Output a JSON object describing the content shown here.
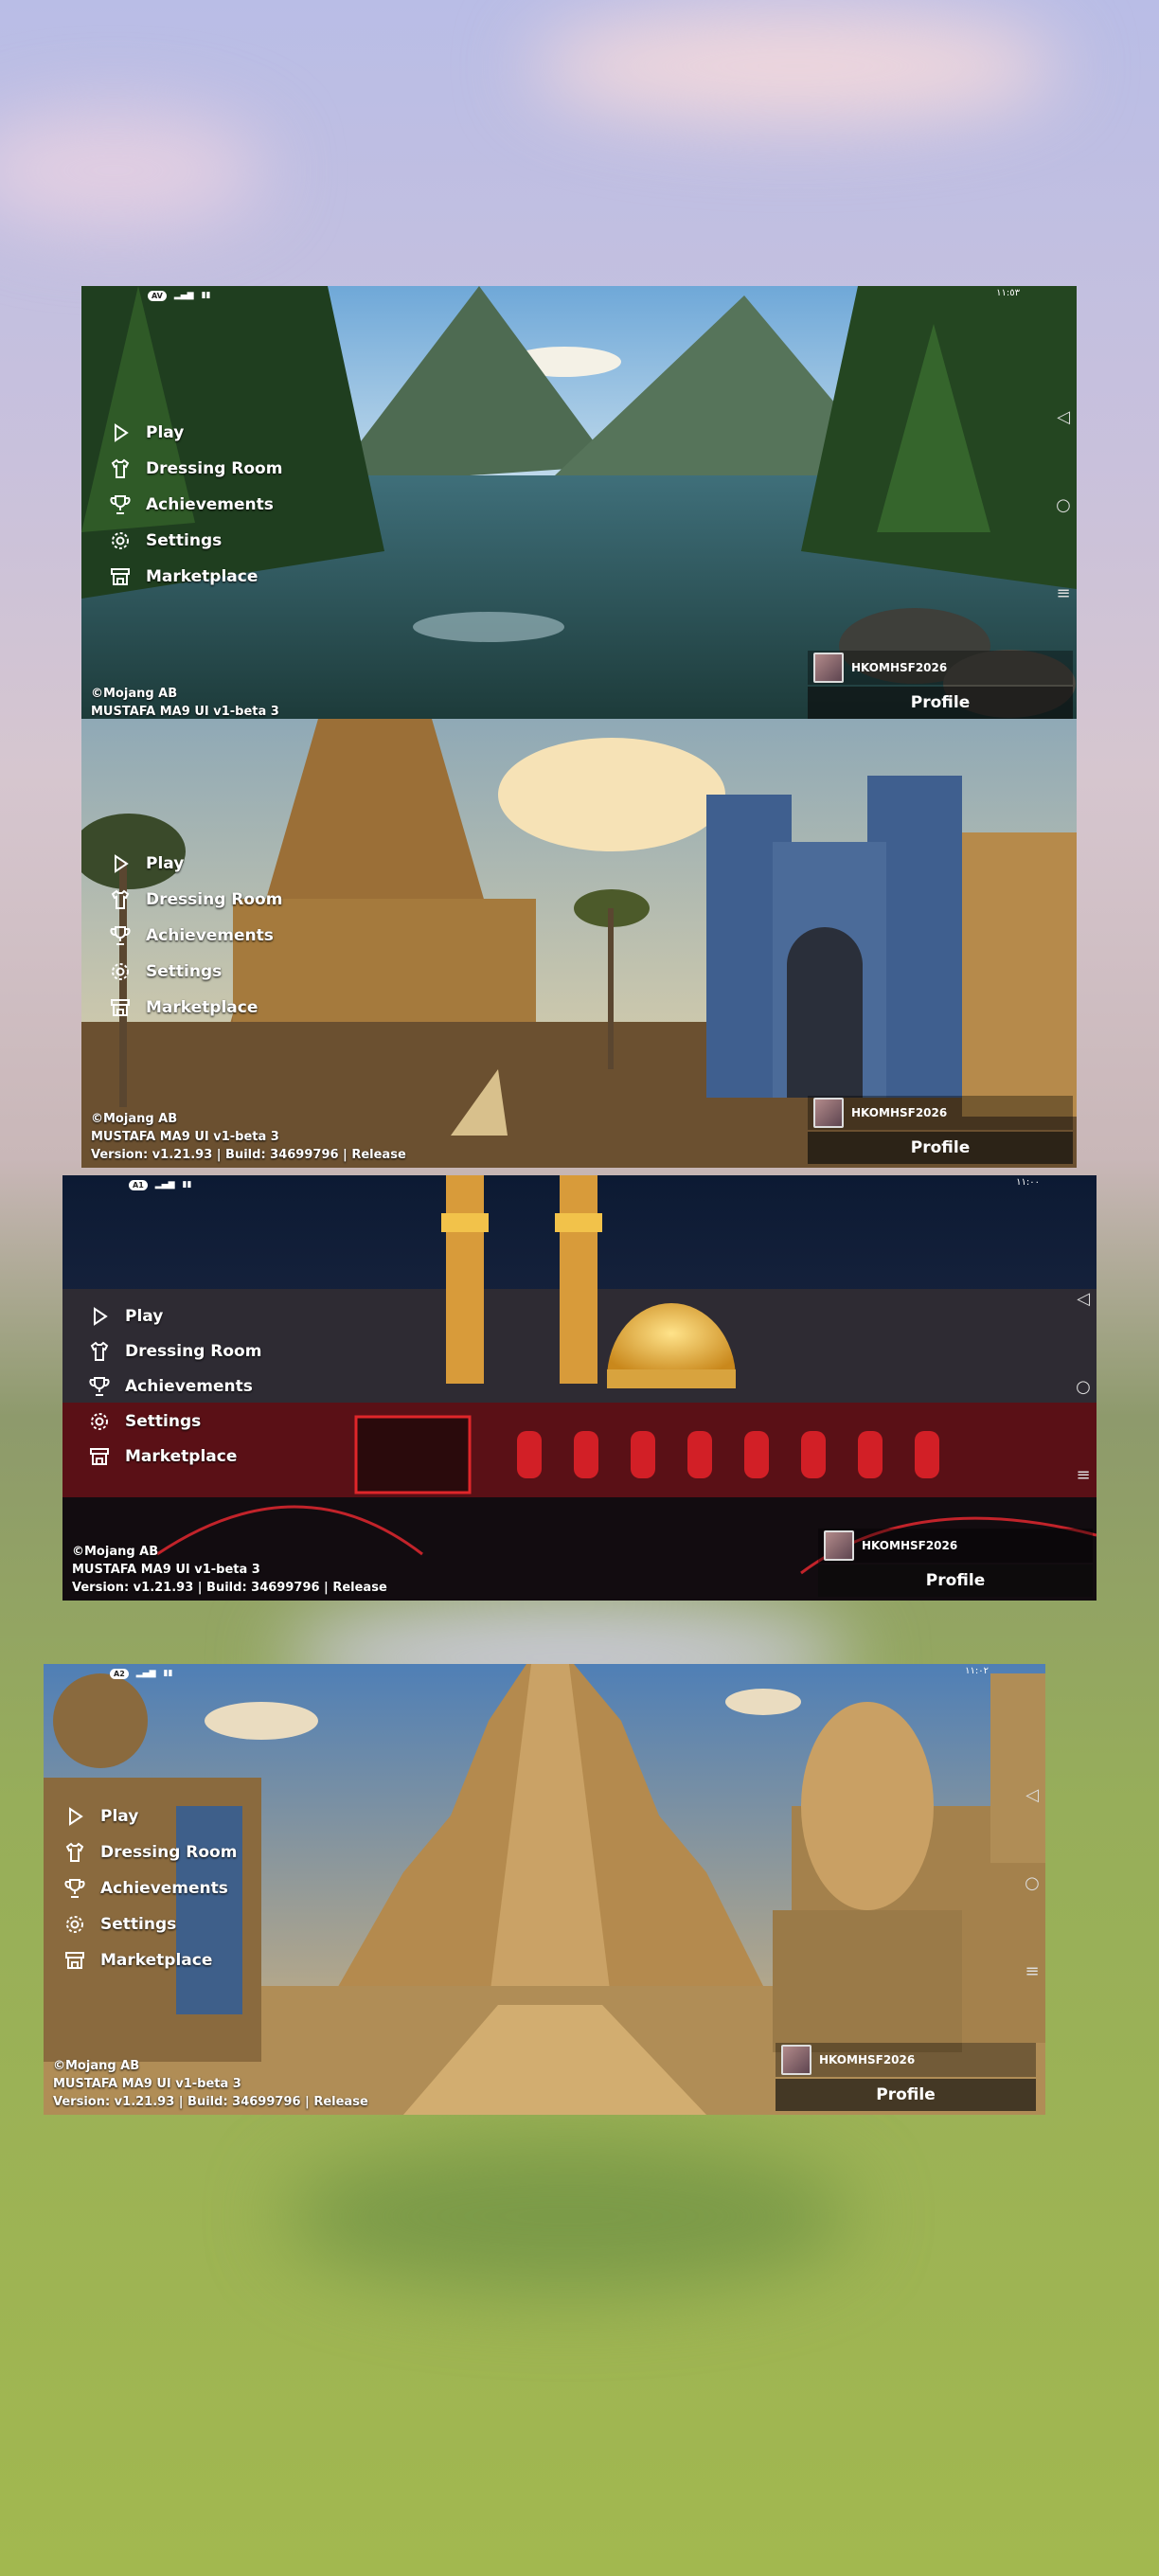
{
  "menu": [
    "Play",
    "Dressing Room",
    "Achievements",
    "Settings",
    "Marketplace"
  ],
  "footer": {
    "copyright": "©Mojang AB",
    "version_name": "MUSTAFA MA9 UI v1-beta 3",
    "build": "Version: v1.21.93 | Build: 34699796 | Release"
  },
  "profile": {
    "username": "HKOMHSF2026",
    "button": "Profile"
  },
  "status": {
    "shot1_time": "١١:٥٣",
    "shot3_time": "١١:٠٠",
    "shot4_time": "١١:٠٢",
    "shot1_pill": "AV",
    "shot3_pill": "A1",
    "shot4_pill": "A2"
  },
  "icons": [
    "play-icon",
    "shirt-icon",
    "trophy-icon",
    "gear-icon",
    "store-icon",
    "back-triangle-icon",
    "home-circle-icon",
    "recents-menu-icon"
  ]
}
